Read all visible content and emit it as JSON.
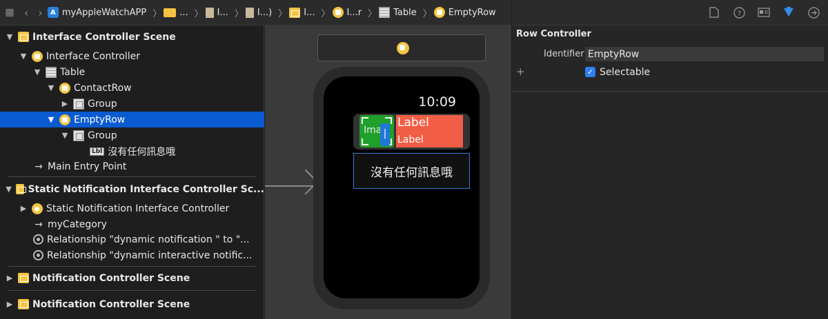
{
  "jumpbar": {
    "project": "myAppleWatchAPP",
    "crumb_folder": "...",
    "crumb_file1": "I...",
    "crumb_file2": "I...)",
    "crumb_storyboard": "I...",
    "crumb_controller": "I...r",
    "crumb_table": "Table",
    "crumb_row": "EmptyRow"
  },
  "outline": {
    "items": [
      {
        "label": "Interface Controller Scene"
      },
      {
        "label": "Interface Controller"
      },
      {
        "label": "Table"
      },
      {
        "label": "ContactRow"
      },
      {
        "label": "Group"
      },
      {
        "label": "EmptyRow"
      },
      {
        "label": "Group"
      },
      {
        "label": "沒有任何訊息哦",
        "badge": "Lbl"
      },
      {
        "label": "Main Entry Point"
      },
      {
        "label": "Static Notification Interface Controller Sc..."
      },
      {
        "label": "Static Notification Interface Controller"
      },
      {
        "label": "myCategory"
      },
      {
        "label": "Relationship \"dynamic notification \" to \"..."
      },
      {
        "label": "Relationship \"dynamic interactive notific..."
      },
      {
        "label": "Notification Controller Scene"
      },
      {
        "label": "Notification Controller Scene"
      }
    ]
  },
  "canvas": {
    "time": "10:09",
    "image_text": "Imag",
    "label_big": "Label",
    "label_small": "Label",
    "empty_text": "沒有任何訊息哦"
  },
  "inspector": {
    "title": "Row Controller",
    "identifier_label": "Identifier",
    "identifier_value": "EmptyRow",
    "plus": "+",
    "selectable_label": "Selectable"
  },
  "colors": {
    "selection": "#0a5bd1",
    "accent": "#2f8cf0",
    "label_bg": "#f15e45",
    "image_bg": "#1fa02a",
    "storyboard_icon": "#f4c542"
  }
}
